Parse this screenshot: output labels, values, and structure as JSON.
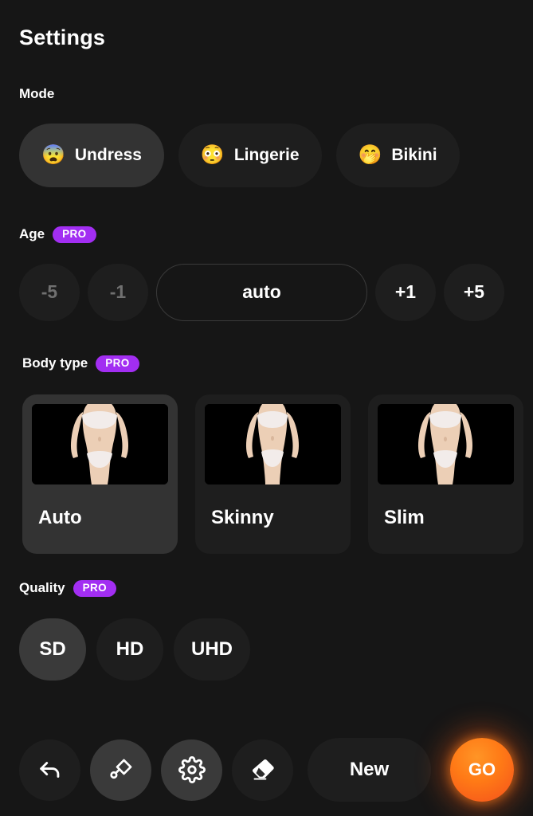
{
  "header": {
    "title": "Settings"
  },
  "mode": {
    "label": "Mode",
    "options": [
      {
        "emoji": "😨",
        "icon_name": "fearful-face-emoji",
        "label": "Undress",
        "selected": true
      },
      {
        "emoji": "😳",
        "icon_name": "flushed-face-emoji",
        "label": "Lingerie",
        "selected": false
      },
      {
        "emoji": "🤭",
        "icon_name": "hand-over-mouth-emoji",
        "label": "Bikini",
        "selected": false
      }
    ]
  },
  "age": {
    "label": "Age",
    "badge": "PRO",
    "options": [
      {
        "label": "-5",
        "disabled": true
      },
      {
        "label": "-1",
        "disabled": true
      },
      {
        "label": "auto",
        "outlined": true
      },
      {
        "label": "+1",
        "disabled": false
      },
      {
        "label": "+5",
        "disabled": false
      }
    ],
    "value": "auto"
  },
  "body_type": {
    "label": "Body type",
    "badge": "PRO",
    "options": [
      {
        "label": "Auto",
        "selected": true
      },
      {
        "label": "Skinny",
        "selected": false
      },
      {
        "label": "Slim",
        "selected": false
      }
    ]
  },
  "quality": {
    "label": "Quality",
    "badge": "PRO",
    "options": [
      {
        "label": "SD",
        "selected": true
      },
      {
        "label": "HD",
        "selected": false
      },
      {
        "label": "UHD",
        "selected": false
      }
    ]
  },
  "toolbar": {
    "undo_icon": "undo-arrow-icon",
    "brush_icon": "paintbrush-icon",
    "settings_icon": "gear-icon",
    "eraser_icon": "eraser-icon",
    "new_label": "New",
    "go_label": "GO"
  },
  "colors": {
    "background": "#161616",
    "surface": "#1e1e1e",
    "surface_selected": "#333333",
    "pro_badge": "#a22ef2",
    "go_button": "#f4501c",
    "text": "#ffffff",
    "text_dim": "#707070"
  }
}
